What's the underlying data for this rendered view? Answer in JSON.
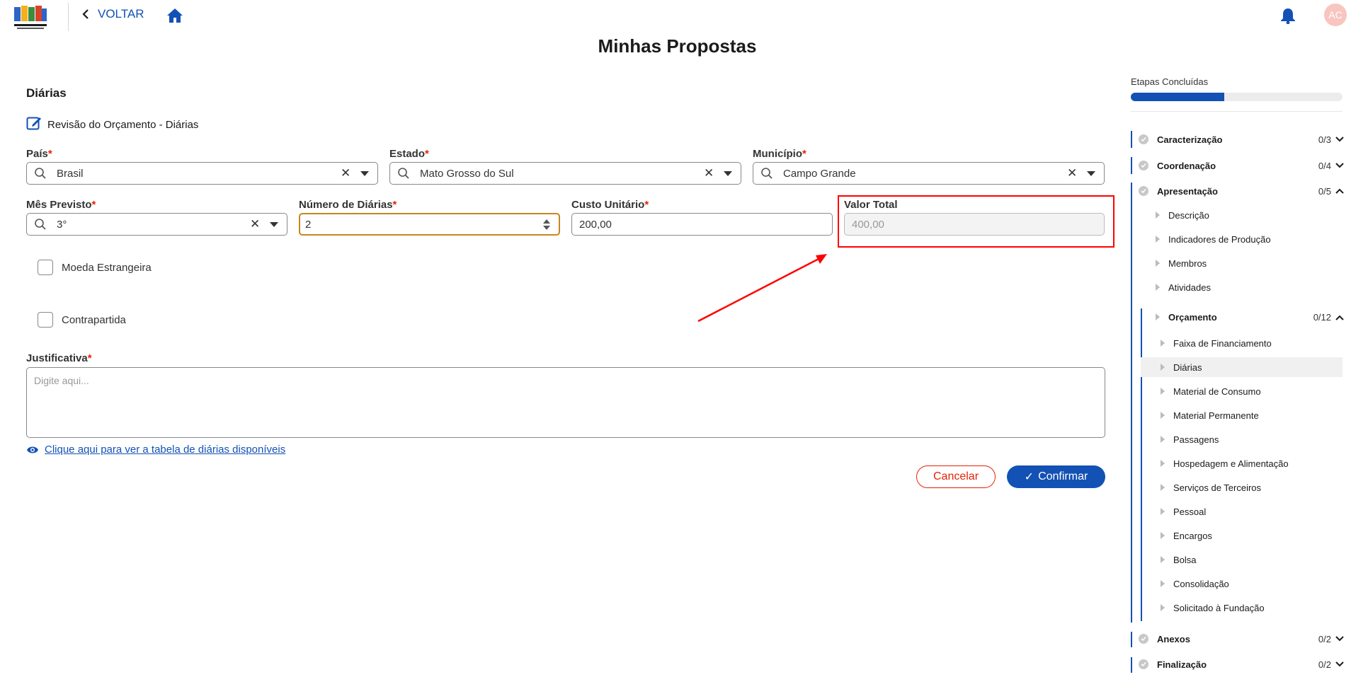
{
  "header": {
    "back_label": "VOLTAR",
    "avatar_initials": "AC"
  },
  "page": {
    "title": "Minhas Propostas"
  },
  "form": {
    "section_title": "Diárias",
    "review_title": "Revisão do Orçamento - Diárias",
    "pais": {
      "label": "País",
      "value": "Brasil"
    },
    "estado": {
      "label": "Estado",
      "value": "Mato Grosso do Sul"
    },
    "municipio": {
      "label": "Município",
      "value": "Campo Grande"
    },
    "mes_previsto": {
      "label": "Mês Previsto",
      "value": "3°"
    },
    "numero_diarias": {
      "label": "Número de Diárias",
      "value": "2"
    },
    "custo_unitario": {
      "label": "Custo Unitário",
      "value": "200,00"
    },
    "valor_total": {
      "label": "Valor Total",
      "value": "400,00"
    },
    "moeda_estrangeira": {
      "label": "Moeda Estrangeira",
      "checked": false
    },
    "contrapartida": {
      "label": "Contrapartida",
      "checked": false
    },
    "justificativa": {
      "label": "Justificativa",
      "placeholder": "Digite aqui..."
    },
    "table_link": "Clique aqui para ver a tabela de diárias disponíveis",
    "cancel_label": "Cancelar",
    "confirm_label": "Confirmar",
    "required_marker": "*"
  },
  "sidebar": {
    "title": "Etapas Concluídas",
    "progress": 0.44,
    "sections": [
      {
        "label": "Caracterização",
        "count": "0/3"
      },
      {
        "label": "Coordenação",
        "count": "0/4"
      },
      {
        "label": "Apresentação",
        "count": "0/5"
      },
      {
        "label": "Anexos",
        "count": "0/2"
      },
      {
        "label": "Finalização",
        "count": "0/2"
      }
    ],
    "apresentacao_items": [
      "Descrição",
      "Indicadores de Produção",
      "Membros",
      "Atividades"
    ],
    "orcamento": {
      "label": "Orçamento",
      "count": "0/12"
    },
    "orcamento_items": [
      "Faixa de Financiamento",
      "Diárias",
      "Material de Consumo",
      "Material Permanente",
      "Passagens",
      "Hospedagem e Alimentação",
      "Serviços de Terceiros",
      "Pessoal",
      "Encargos",
      "Bolsa",
      "Consolidação",
      "Solicitado à Fundação"
    ]
  },
  "colors": {
    "primary": "#1351b4",
    "danger": "#e52207",
    "highlight": "#ff0000"
  }
}
